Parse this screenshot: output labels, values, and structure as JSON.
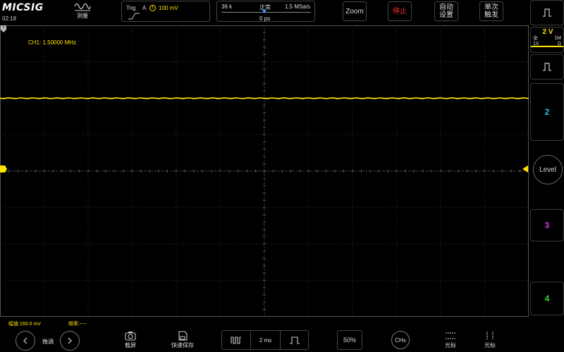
{
  "topbar": {
    "logo": "MICSIG",
    "clock": "02:18",
    "measure_label": "测量",
    "trigger": {
      "label": "Trig",
      "source": "A",
      "channel_badge": "1",
      "level": "100 mV"
    },
    "acquisition": {
      "memory": "36 k",
      "mode": "正常",
      "sample_rate": "1.5 MSa/s",
      "h_position": "0 ps"
    },
    "zoom_label": "Zoom",
    "stop_label": "停止",
    "auto_label": "自动\n设置",
    "single_label": "单次\n触发",
    "colors": {
      "stop": "#ff3030",
      "marker": "#3aa0ff"
    }
  },
  "screen": {
    "channel_freq": "CH1: 1.50000 MHz",
    "ch1_marker": "1",
    "trace_color": "#ffe400"
  },
  "right_panel": {
    "ch1_scale": "2 V",
    "ch1_coupling": "全\n1X",
    "ch1_impedance": "1M\nΩ",
    "ch2_label": "2",
    "level_label": "Level",
    "ch3_label": "3",
    "ch4_label": "4",
    "colors": {
      "ch1": "#ffe400",
      "ch2": "#35b8ff",
      "ch3": "#e030e0",
      "ch4": "#30e030"
    }
  },
  "measurements": {
    "amplitude": "幅值:160.0 mV",
    "frequency": "频率:----"
  },
  "bottom_bar": {
    "fine_label": "微调",
    "screenshot_label": "截屏",
    "quick_save_label": "快速保存",
    "timebase": "2 ms",
    "percent_label": "50%",
    "chx_label": "CHx",
    "cursor_h_label": "光标",
    "cursor_v_label": "光标"
  }
}
